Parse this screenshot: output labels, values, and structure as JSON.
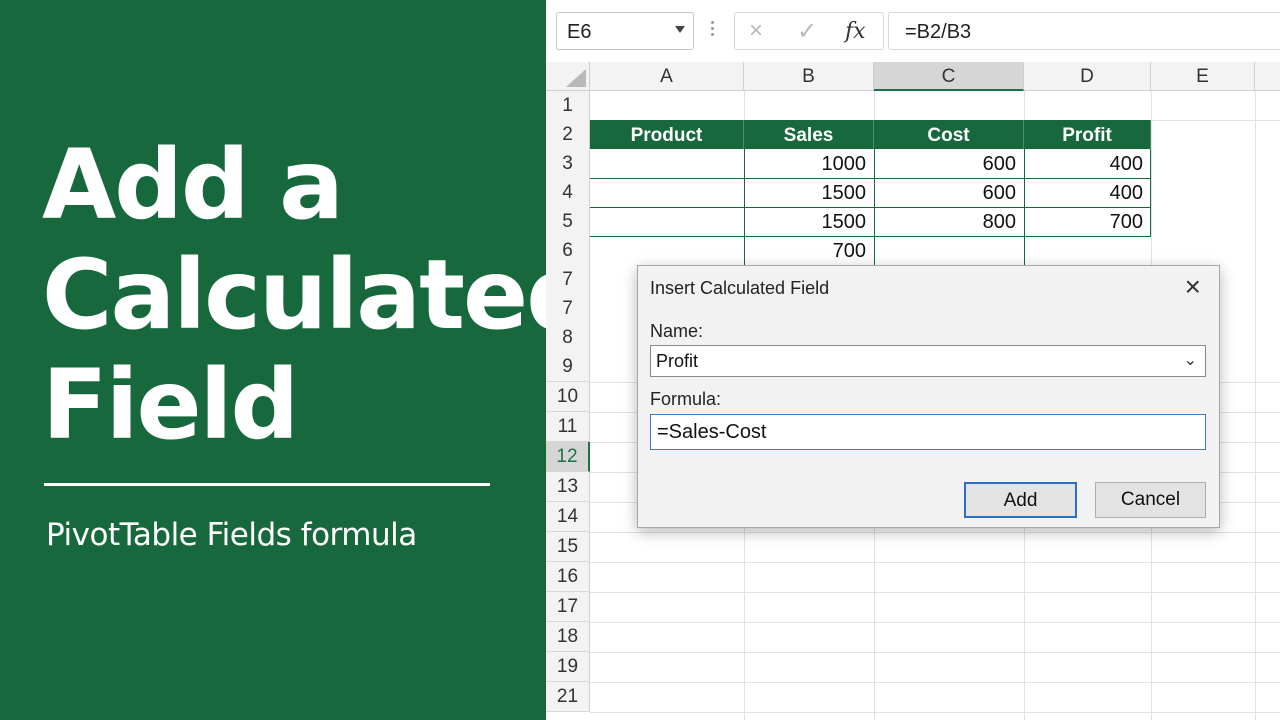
{
  "hero": {
    "title_lines": [
      "Add a",
      "Calculated",
      "Field"
    ],
    "subtitle": "PivotTable Fields formula"
  },
  "formula_bar": {
    "name_box": "E6",
    "cancel_icon": "×",
    "confirm_icon": "✓",
    "fx_label": "fx",
    "formula": "=B2/B3"
  },
  "sheet": {
    "columns": [
      "A",
      "B",
      "C",
      "D",
      "E"
    ],
    "selected_column": "C",
    "rows": [
      "1",
      "2",
      "3",
      "4",
      "5",
      "6",
      "7",
      "7",
      "8",
      "9",
      "10",
      "11",
      "12",
      "13",
      "14",
      "15",
      "16",
      "17",
      "18",
      "19",
      "21"
    ],
    "selected_row": "12",
    "table_headers": [
      "Product",
      "Sales",
      "Cost",
      "Profit"
    ],
    "table_rows": [
      {
        "product": "",
        "sales": "1000",
        "cost": "600",
        "profit": "400"
      },
      {
        "product": "",
        "sales": "1500",
        "cost": "600",
        "profit": "400"
      },
      {
        "product": "",
        "sales": "1500",
        "cost": "800",
        "profit": "700"
      },
      {
        "product": "",
        "sales": "700",
        "cost": "",
        "profit": ""
      }
    ],
    "accent_color": "#17693d"
  },
  "dialog": {
    "title": "Insert Calculated Field",
    "close_icon": "×",
    "name_label": "Name:",
    "name_value": "Profit",
    "formula_label": "Formula:",
    "formula_value": "=Sales-Cost",
    "add_label": "Add",
    "cancel_label": "Cancel"
  }
}
